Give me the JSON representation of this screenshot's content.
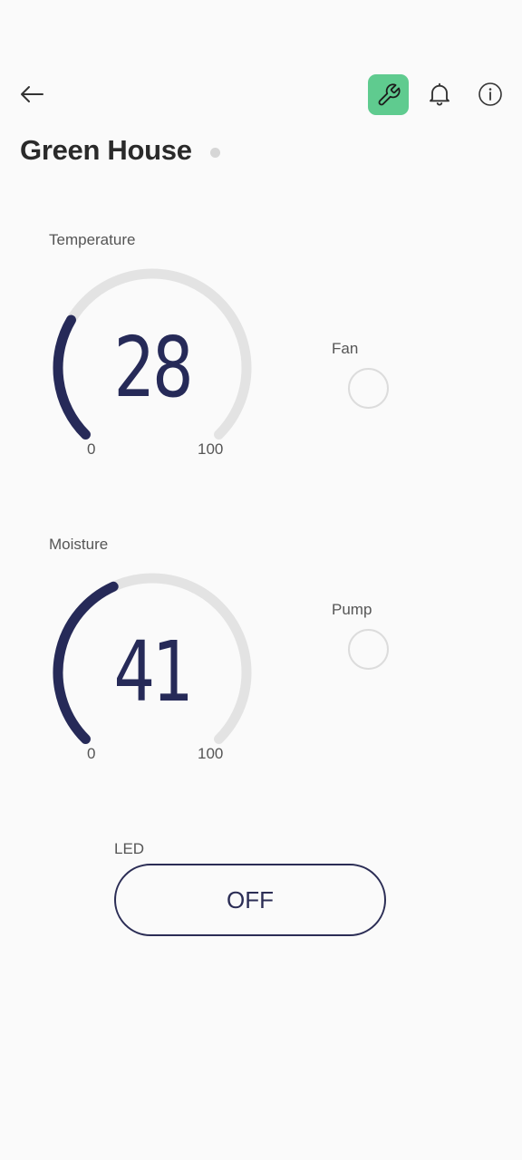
{
  "header": {
    "title": "Green House",
    "back_icon": "arrow-left-icon",
    "tool_icon": "wrench-icon",
    "bell_icon": "bell-icon",
    "info_icon": "info-icon"
  },
  "colors": {
    "accent_green": "#5fcb8f",
    "gauge_fill": "#262a58",
    "gauge_track": "#e3e3e3",
    "status_dot": "#d6d6d6"
  },
  "temperature": {
    "label": "Temperature",
    "value": "28",
    "fraction": 0.28,
    "min": "0",
    "max": "100"
  },
  "fan": {
    "label": "Fan"
  },
  "moisture": {
    "label": "Moisture",
    "value": "41",
    "fraction": 0.41,
    "min": "0",
    "max": "100"
  },
  "pump": {
    "label": "Pump"
  },
  "led": {
    "label": "LED",
    "button_label": "OFF"
  }
}
